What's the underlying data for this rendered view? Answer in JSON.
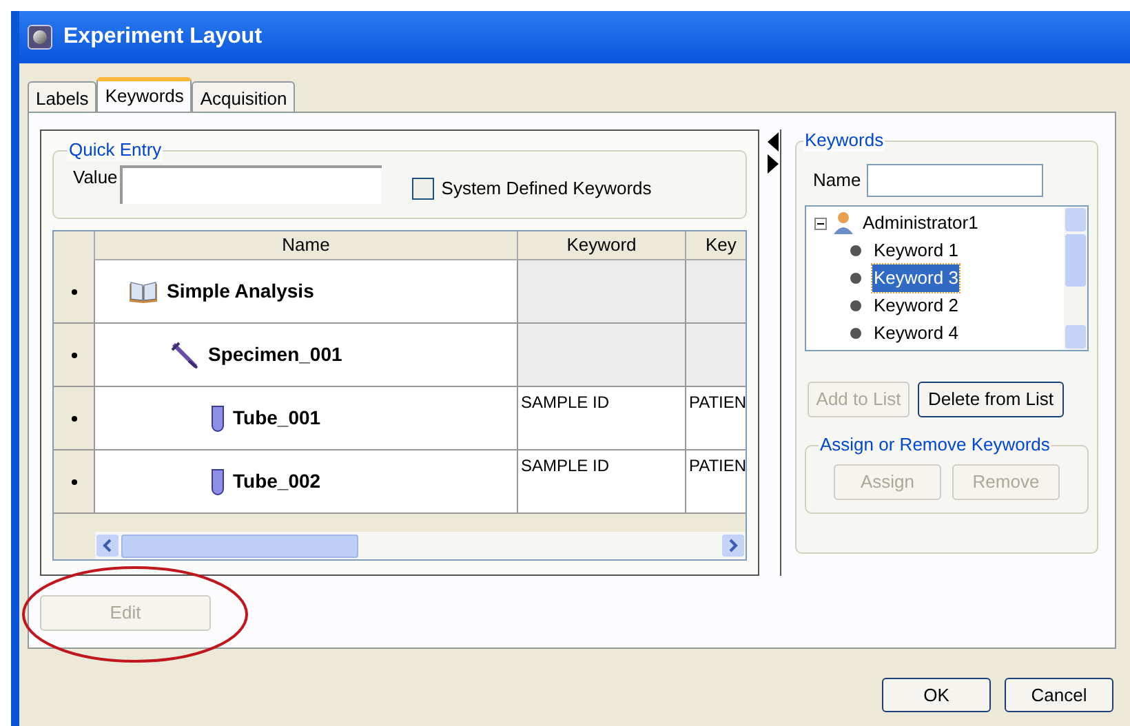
{
  "window": {
    "title": "Experiment Layout"
  },
  "tabs": [
    {
      "label": "Labels",
      "selected": false
    },
    {
      "label": "Keywords",
      "selected": true
    },
    {
      "label": "Acquisition",
      "selected": false
    }
  ],
  "quick_entry": {
    "title": "Quick Entry",
    "value_label": "Value",
    "system_keywords": {
      "label": "System Defined Keywords",
      "checked": false
    }
  },
  "table": {
    "columns": [
      "Name",
      "Keyword",
      "Key"
    ],
    "rows": [
      {
        "name": "Simple Analysis",
        "kind": "analysis",
        "disabled": true,
        "children": [
          {
            "name": "Specimen_001",
            "kind": "specimen",
            "disabled": true,
            "children": [
              {
                "name": "Tube_001",
                "kind": "tube",
                "disabled": false,
                "cells": [
                  "SAMPLE ID",
                  "PATIEN"
                ]
              },
              {
                "name": "Tube_002",
                "kind": "tube",
                "disabled": false,
                "cells": [
                  "SAMPLE ID",
                  "PATIEN"
                ]
              }
            ]
          }
        ]
      }
    ]
  },
  "edit_button": {
    "label": "Edit",
    "disabled": true
  },
  "keywords": {
    "title": "Keywords",
    "name_label": "Name",
    "tree": {
      "name": "Administrator1",
      "expanded": true,
      "children": [
        {
          "name": "Keyword 1",
          "selected": false
        },
        {
          "name": "Keyword 3",
          "selected": true
        },
        {
          "name": "Keyword 2",
          "selected": false
        },
        {
          "name": "Keyword 4",
          "selected": false
        }
      ]
    },
    "buttons": [
      {
        "label": "Add to List",
        "disabled": true
      },
      {
        "label": "Delete from List",
        "disabled": false
      }
    ],
    "assign_group": {
      "title": "Assign or Remove Keywords",
      "buttons": [
        {
          "label": "Assign",
          "disabled": true
        },
        {
          "label": "Remove",
          "disabled": true
        }
      ]
    }
  },
  "footer_buttons": [
    {
      "label": "OK"
    },
    {
      "label": "Cancel"
    }
  ]
}
